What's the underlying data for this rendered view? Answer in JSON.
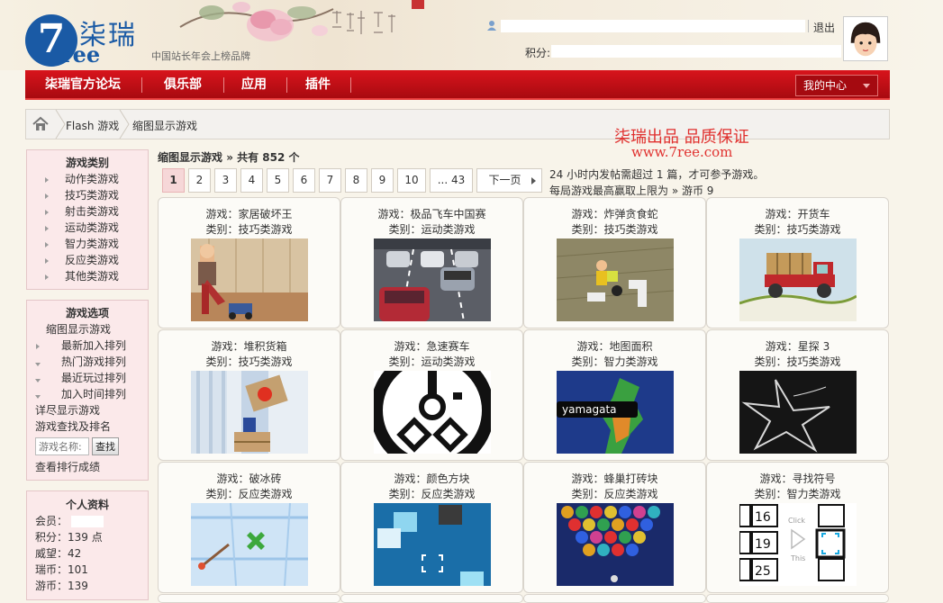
{
  "header": {
    "logo_number": "7",
    "logo_latin": "ree",
    "logo_chinese": "柒瑞",
    "slogan": "中国站长年会上榜品牌",
    "logout": "退出",
    "points_label": "积分:"
  },
  "nav": {
    "items": [
      "柒瑞官方论坛",
      "俱乐部",
      "应用",
      "插件"
    ],
    "my_center": "我的中心"
  },
  "breadcrumb": {
    "items": [
      "Flash 游戏",
      "缩图显示游戏"
    ]
  },
  "sidebar": {
    "categories_title": "游戏类别",
    "categories": [
      "动作类游戏",
      "技巧类游戏",
      "射击类游戏",
      "运动类游戏",
      "智力类游戏",
      "反应类游戏",
      "其他类游戏"
    ],
    "options_title": "游戏选项",
    "options_header": "缩图显示游戏",
    "sort_items": [
      "最新加入排列",
      "热门游戏排列",
      "最近玩过排列",
      "加入时间排列"
    ],
    "detail_view": "详尽显示游戏",
    "search_label": "游戏查找及排名",
    "search_placeholder": "游戏名称:",
    "search_button": "查找",
    "ranking": "查看排行成绩",
    "profile_title": "个人资料",
    "profile": {
      "member_label": "会员：",
      "points": "积分：139 点",
      "prestige": "威望：42",
      "ruibi": "瑞币：101",
      "youbi": "游币：139"
    }
  },
  "main": {
    "title_prefix": "缩图显示游戏",
    "title_count": "» 共有 852 个",
    "promo": "柒瑞出品 品质保证",
    "promo_url": "www.7ree.com",
    "rule1": "24 小时内发帖需超过 1 篇，才可参予游戏。",
    "rule2": "每局游戏最高赢取上限为 » 游币 9",
    "pages": [
      "1",
      "2",
      "3",
      "4",
      "5",
      "6",
      "7",
      "8",
      "9",
      "10",
      "... 43",
      "下一页"
    ],
    "active_page": "1"
  },
  "games": [
    {
      "name": "游戏：家居破坏王",
      "category": "类别：技巧类游戏",
      "thumb": "kid"
    },
    {
      "name": "游戏：极品飞车中国赛",
      "category": "类别：运动类游戏",
      "thumb": "cars"
    },
    {
      "name": "游戏：炸弹贪食蛇",
      "category": "类别：技巧类游戏",
      "thumb": "snake"
    },
    {
      "name": "游戏：开货车",
      "category": "类别：技巧类游戏",
      "thumb": "truck"
    },
    {
      "name": "游戏：堆积货箱",
      "category": "类别：技巧类游戏",
      "thumb": "boxes"
    },
    {
      "name": "游戏：急速赛车",
      "category": "类别：运动类游戏",
      "thumb": "circuit"
    },
    {
      "name": "游戏：地图面积",
      "category": "类别：智力类游戏",
      "thumb": "map",
      "thumb_text": "yamagata"
    },
    {
      "name": "游戏：星探 3",
      "category": "类别：技巧类游戏",
      "thumb": "star"
    },
    {
      "name": "游戏：破冰砖",
      "category": "类别：反应类游戏",
      "thumb": "ice"
    },
    {
      "name": "游戏：颜色方块",
      "category": "类别：反应类游戏",
      "thumb": "colorblock"
    },
    {
      "name": "游戏：蜂巢打砖块",
      "category": "类别：反应类游戏",
      "thumb": "bubbles"
    },
    {
      "name": "游戏：寻找符号",
      "category": "类别：智力类游戏",
      "thumb": "symbols",
      "thumb_text": [
        "16",
        "19",
        "25",
        "Click",
        "This"
      ]
    }
  ],
  "colors": {
    "nav_red": "#c80f16",
    "promo_red": "#e0302e",
    "logo_blue": "#1a5aa5",
    "side_pink": "#fbe9ea",
    "active_page": "#f6d7d8"
  }
}
